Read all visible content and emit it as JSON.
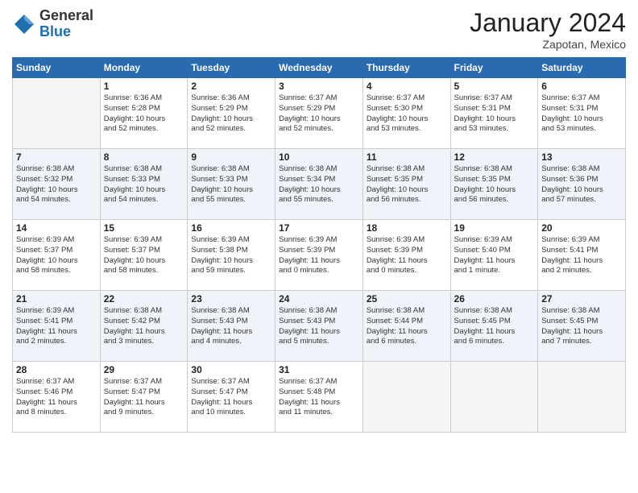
{
  "header": {
    "logo_general": "General",
    "logo_blue": "Blue",
    "month_title": "January 2024",
    "location": "Zapotan, Mexico"
  },
  "columns": [
    "Sunday",
    "Monday",
    "Tuesday",
    "Wednesday",
    "Thursday",
    "Friday",
    "Saturday"
  ],
  "weeks": [
    {
      "alt": false,
      "days": [
        {
          "num": "",
          "info": ""
        },
        {
          "num": "1",
          "info": "Sunrise: 6:36 AM\nSunset: 5:28 PM\nDaylight: 10 hours\nand 52 minutes."
        },
        {
          "num": "2",
          "info": "Sunrise: 6:36 AM\nSunset: 5:29 PM\nDaylight: 10 hours\nand 52 minutes."
        },
        {
          "num": "3",
          "info": "Sunrise: 6:37 AM\nSunset: 5:29 PM\nDaylight: 10 hours\nand 52 minutes."
        },
        {
          "num": "4",
          "info": "Sunrise: 6:37 AM\nSunset: 5:30 PM\nDaylight: 10 hours\nand 53 minutes."
        },
        {
          "num": "5",
          "info": "Sunrise: 6:37 AM\nSunset: 5:31 PM\nDaylight: 10 hours\nand 53 minutes."
        },
        {
          "num": "6",
          "info": "Sunrise: 6:37 AM\nSunset: 5:31 PM\nDaylight: 10 hours\nand 53 minutes."
        }
      ]
    },
    {
      "alt": true,
      "days": [
        {
          "num": "7",
          "info": "Sunrise: 6:38 AM\nSunset: 5:32 PM\nDaylight: 10 hours\nand 54 minutes."
        },
        {
          "num": "8",
          "info": "Sunrise: 6:38 AM\nSunset: 5:33 PM\nDaylight: 10 hours\nand 54 minutes."
        },
        {
          "num": "9",
          "info": "Sunrise: 6:38 AM\nSunset: 5:33 PM\nDaylight: 10 hours\nand 55 minutes."
        },
        {
          "num": "10",
          "info": "Sunrise: 6:38 AM\nSunset: 5:34 PM\nDaylight: 10 hours\nand 55 minutes."
        },
        {
          "num": "11",
          "info": "Sunrise: 6:38 AM\nSunset: 5:35 PM\nDaylight: 10 hours\nand 56 minutes."
        },
        {
          "num": "12",
          "info": "Sunrise: 6:38 AM\nSunset: 5:35 PM\nDaylight: 10 hours\nand 56 minutes."
        },
        {
          "num": "13",
          "info": "Sunrise: 6:38 AM\nSunset: 5:36 PM\nDaylight: 10 hours\nand 57 minutes."
        }
      ]
    },
    {
      "alt": false,
      "days": [
        {
          "num": "14",
          "info": "Sunrise: 6:39 AM\nSunset: 5:37 PM\nDaylight: 10 hours\nand 58 minutes."
        },
        {
          "num": "15",
          "info": "Sunrise: 6:39 AM\nSunset: 5:37 PM\nDaylight: 10 hours\nand 58 minutes."
        },
        {
          "num": "16",
          "info": "Sunrise: 6:39 AM\nSunset: 5:38 PM\nDaylight: 10 hours\nand 59 minutes."
        },
        {
          "num": "17",
          "info": "Sunrise: 6:39 AM\nSunset: 5:39 PM\nDaylight: 11 hours\nand 0 minutes."
        },
        {
          "num": "18",
          "info": "Sunrise: 6:39 AM\nSunset: 5:39 PM\nDaylight: 11 hours\nand 0 minutes."
        },
        {
          "num": "19",
          "info": "Sunrise: 6:39 AM\nSunset: 5:40 PM\nDaylight: 11 hours\nand 1 minute."
        },
        {
          "num": "20",
          "info": "Sunrise: 6:39 AM\nSunset: 5:41 PM\nDaylight: 11 hours\nand 2 minutes."
        }
      ]
    },
    {
      "alt": true,
      "days": [
        {
          "num": "21",
          "info": "Sunrise: 6:39 AM\nSunset: 5:41 PM\nDaylight: 11 hours\nand 2 minutes."
        },
        {
          "num": "22",
          "info": "Sunrise: 6:38 AM\nSunset: 5:42 PM\nDaylight: 11 hours\nand 3 minutes."
        },
        {
          "num": "23",
          "info": "Sunrise: 6:38 AM\nSunset: 5:43 PM\nDaylight: 11 hours\nand 4 minutes."
        },
        {
          "num": "24",
          "info": "Sunrise: 6:38 AM\nSunset: 5:43 PM\nDaylight: 11 hours\nand 5 minutes."
        },
        {
          "num": "25",
          "info": "Sunrise: 6:38 AM\nSunset: 5:44 PM\nDaylight: 11 hours\nand 6 minutes."
        },
        {
          "num": "26",
          "info": "Sunrise: 6:38 AM\nSunset: 5:45 PM\nDaylight: 11 hours\nand 6 minutes."
        },
        {
          "num": "27",
          "info": "Sunrise: 6:38 AM\nSunset: 5:45 PM\nDaylight: 11 hours\nand 7 minutes."
        }
      ]
    },
    {
      "alt": false,
      "days": [
        {
          "num": "28",
          "info": "Sunrise: 6:37 AM\nSunset: 5:46 PM\nDaylight: 11 hours\nand 8 minutes."
        },
        {
          "num": "29",
          "info": "Sunrise: 6:37 AM\nSunset: 5:47 PM\nDaylight: 11 hours\nand 9 minutes."
        },
        {
          "num": "30",
          "info": "Sunrise: 6:37 AM\nSunset: 5:47 PM\nDaylight: 11 hours\nand 10 minutes."
        },
        {
          "num": "31",
          "info": "Sunrise: 6:37 AM\nSunset: 5:48 PM\nDaylight: 11 hours\nand 11 minutes."
        },
        {
          "num": "",
          "info": ""
        },
        {
          "num": "",
          "info": ""
        },
        {
          "num": "",
          "info": ""
        }
      ]
    }
  ]
}
